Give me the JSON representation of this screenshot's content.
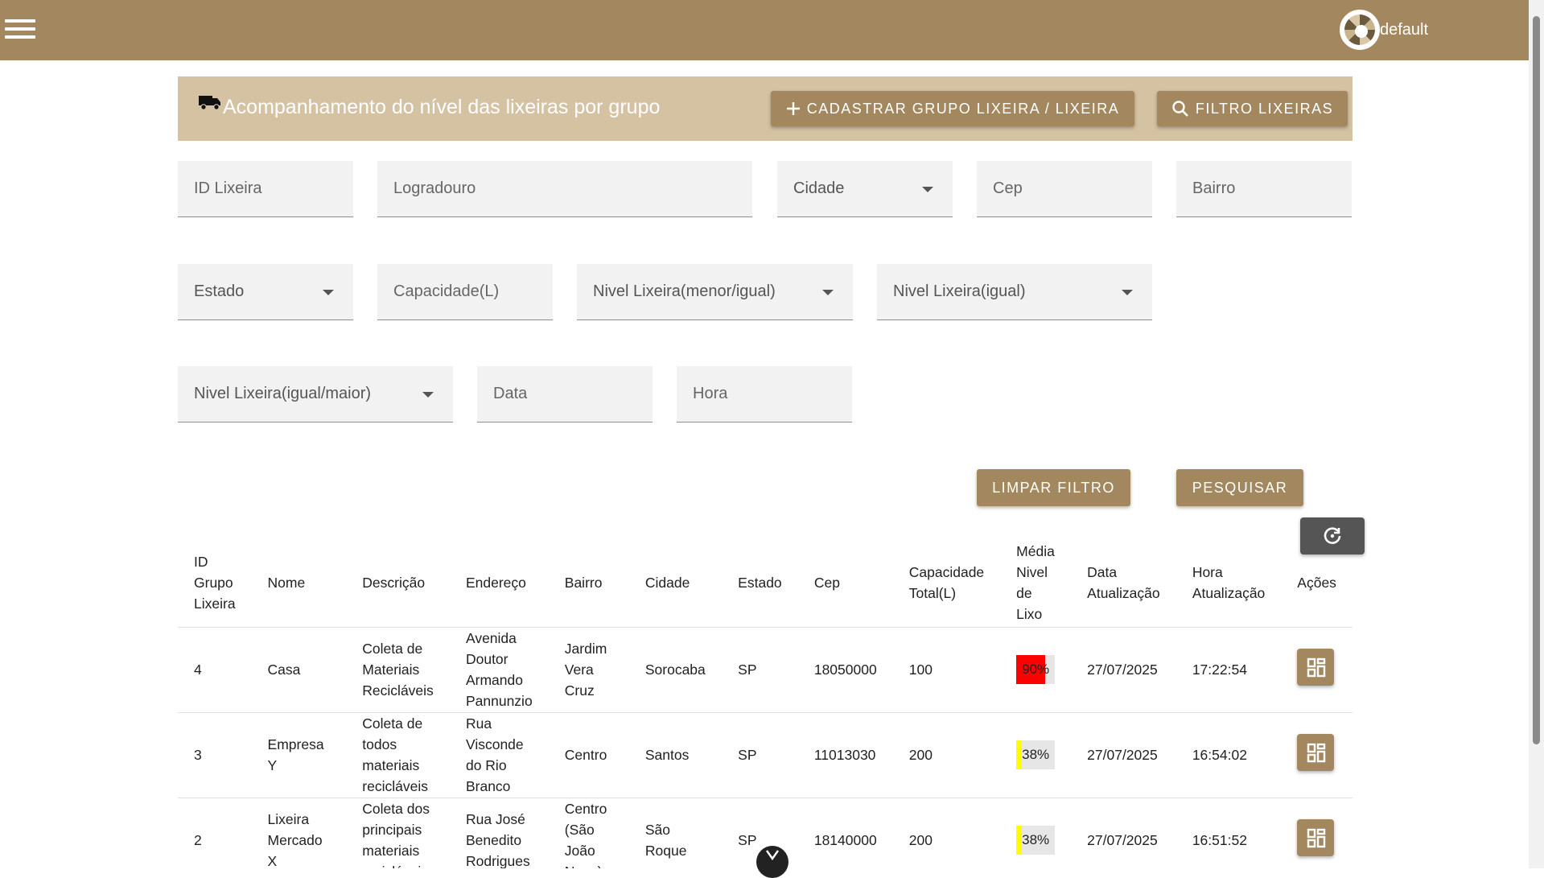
{
  "topbar": {
    "user_name": "default"
  },
  "header": {
    "title": "Acompanhamento do nível das lixeiras por grupo",
    "btn_cadastrar": "CADASTRAR GRUPO LIXEIRA / LIXEIRA",
    "btn_filtro": "FILTRO LIXEIRAS"
  },
  "filters": {
    "id_lixeira": "ID Lixeira",
    "logradouro": "Logradouro",
    "cidade": "Cidade",
    "cep": "Cep",
    "bairro": "Bairro",
    "estado": "Estado",
    "capacidade": "Capacidade(L)",
    "nivel_menor": "Nivel Lixeira(menor/igual)",
    "nivel_igual": "Nivel Lixeira(igual)",
    "nivel_maior": "Nivel Lixeira(igual/maior)",
    "data": "Data",
    "hora": "Hora",
    "btn_limpar": "LIMPAR FILTRO",
    "btn_pesquisar": "PESQUISAR"
  },
  "table": {
    "headers": [
      "ID Grupo Lixeira",
      "Nome",
      "Descrição",
      "Endereço",
      "Bairro",
      "Cidade",
      "Estado",
      "Cep",
      "Capacidade Total(L)",
      "Média Nivel de Lixo",
      "Data Atualização",
      "Hora Atualização",
      "Ações"
    ],
    "rows": [
      {
        "id": "4",
        "nome": "Casa",
        "descricao": "Coleta de Materiais Recicláveis",
        "endereco": "Avenida Doutor Armando Pannunzio",
        "bairro": "Jardim Vera Cruz",
        "cidade": "Sorocaba",
        "estado": "SP",
        "cep": "18050000",
        "capacidade": "100",
        "nivel": "90%",
        "nivel_value": 90,
        "nivel_color": "#ff0000",
        "data": "27/07/2025",
        "hora": "17:22:54"
      },
      {
        "id": "3",
        "nome": "Empresa Y",
        "descricao": "Coleta de todos materiais recicláveis",
        "endereco": "Rua Visconde do Rio Branco",
        "bairro": "Centro",
        "cidade": "Santos",
        "estado": "SP",
        "cep": "11013030",
        "capacidade": "200",
        "nivel": "38%",
        "nivel_value": 38,
        "nivel_color": "#ffff00",
        "data": "27/07/2025",
        "hora": "16:54:02"
      },
      {
        "id": "2",
        "nome": "Lixeira Mercado X",
        "descricao": "Coleta dos principais materiais recicláveis",
        "endereco": "Rua José Benedito Rodrigues",
        "bairro": "Centro (São João Novo)",
        "cidade": "São Roque",
        "estado": "SP",
        "cep": "18140000",
        "capacidade": "200",
        "nivel": "38%",
        "nivel_value": 38,
        "nivel_color": "#ffff00",
        "data": "27/07/2025",
        "hora": "16:51:52"
      }
    ]
  },
  "icons": {
    "menu": "menu-icon",
    "truck": "truck-icon",
    "plus": "plus-icon",
    "search": "search-icon",
    "refresh": "refresh-icon",
    "action": "dashboard-icon",
    "down": "chevron-down-icon"
  },
  "colors": {
    "brand": "#a3875e",
    "header_card": "#d4c2a3",
    "field_bg": "#f2f2f2"
  }
}
